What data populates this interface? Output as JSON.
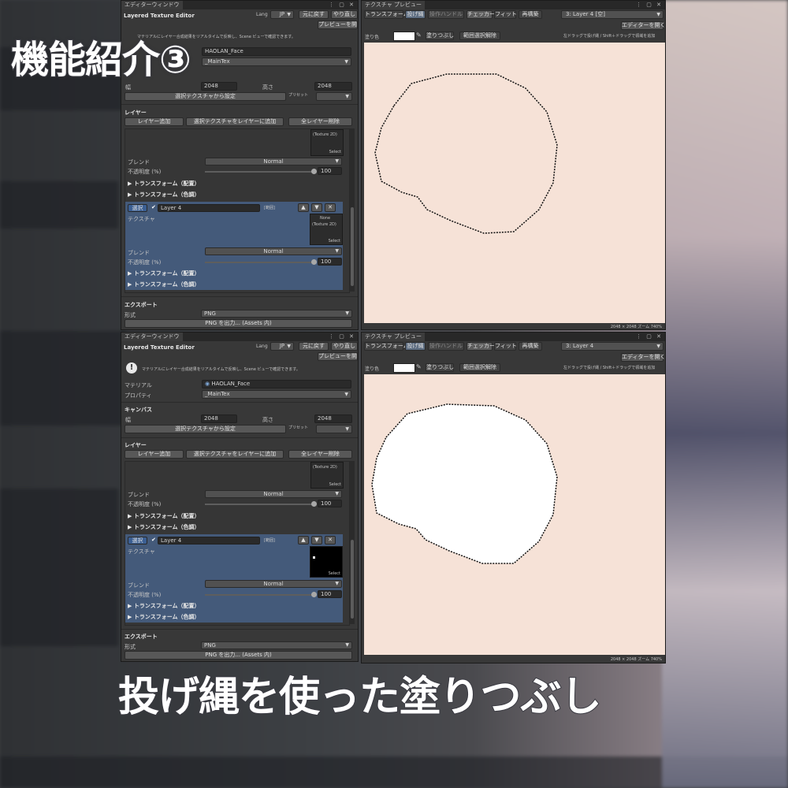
{
  "overlay": {
    "title": "機能紹介③",
    "caption_plain": "投げ縄を使った",
    "caption_highlight": "塗りつぶし"
  },
  "editor_window": {
    "tab": "エディターウィンドウ",
    "window_buttons": "⋮ ▢ ✕",
    "title": "Layered Texture Editor",
    "lang_label": "Lang",
    "lang_value": "JP",
    "undo_label": "元に戻す",
    "redo_label": "やり直し",
    "open_preview_label": "プレビューを開く",
    "info_text": "マテリアルにレイヤー合成結果をリアルタイムで反映し、Scene ビューで確認できます。",
    "material_label": "マテリアル",
    "material_value": "HAOLAN_Face",
    "property_label": "プロパティ",
    "property_value": "_MainTex",
    "canvas_section": "キャンバス",
    "width_label": "幅",
    "width_value": "2048",
    "height_label": "高さ",
    "height_value": "2048",
    "preset_label": "プリセット",
    "set_from_texture_label": "選択テクスチャから設定",
    "layer_section": "レイヤー",
    "add_layer_label": "レイヤー追加",
    "add_selected_texture_label": "選択テクスチャをレイヤーに追加",
    "delete_all_layers_label": "全レイヤー削除",
    "texture2d_label": "(Texture 2D)",
    "select_label": "Select",
    "blend_label": "ブレンド",
    "blend_value": "Normal",
    "opacity_label": "不透明度 (%)",
    "opacity_value": "100",
    "transform_place_label": "トランスフォーム（配置）",
    "transform_color_label": "トランスフォーム（色調）",
    "layer_select_label": "選択",
    "layer_name": "Layer 4",
    "layer_scope_tag": "[範囲]",
    "texture_label": "テクスチャ",
    "none_label": "None",
    "export_section": "エクスポート",
    "format_label": "形式",
    "format_value": "PNG",
    "export_button_label": "PNG を出力... (Assets 内)",
    "move_up_icon": "▲",
    "move_down_icon": "▼",
    "delete_icon": "✕"
  },
  "preview_window": {
    "tab": "テクスチャ プレビュー",
    "window_buttons": "⋮ ▢ ✕",
    "tools": [
      "トランスフォーム",
      "投げ縄",
      "操作ハンドル",
      "チェッカー",
      "フィット",
      "再構築"
    ],
    "layer_dropdown_top": "3: Layer 4 [空]",
    "layer_dropdown_bottom": "3: Layer 4",
    "open_editor_label": "エディターを開く",
    "fill_color_label": "塗り色",
    "fill_button_label": "塗りつぶし",
    "clear_selection_label": "範囲選択解除",
    "hint": "左ドラッグで投げ縄 / Shift＋ドラッグで領域を追加",
    "status": "2048 × 2048  ズーム 740%",
    "fill_color": "#ffffff",
    "canvas_color": "#f6e2d7"
  }
}
